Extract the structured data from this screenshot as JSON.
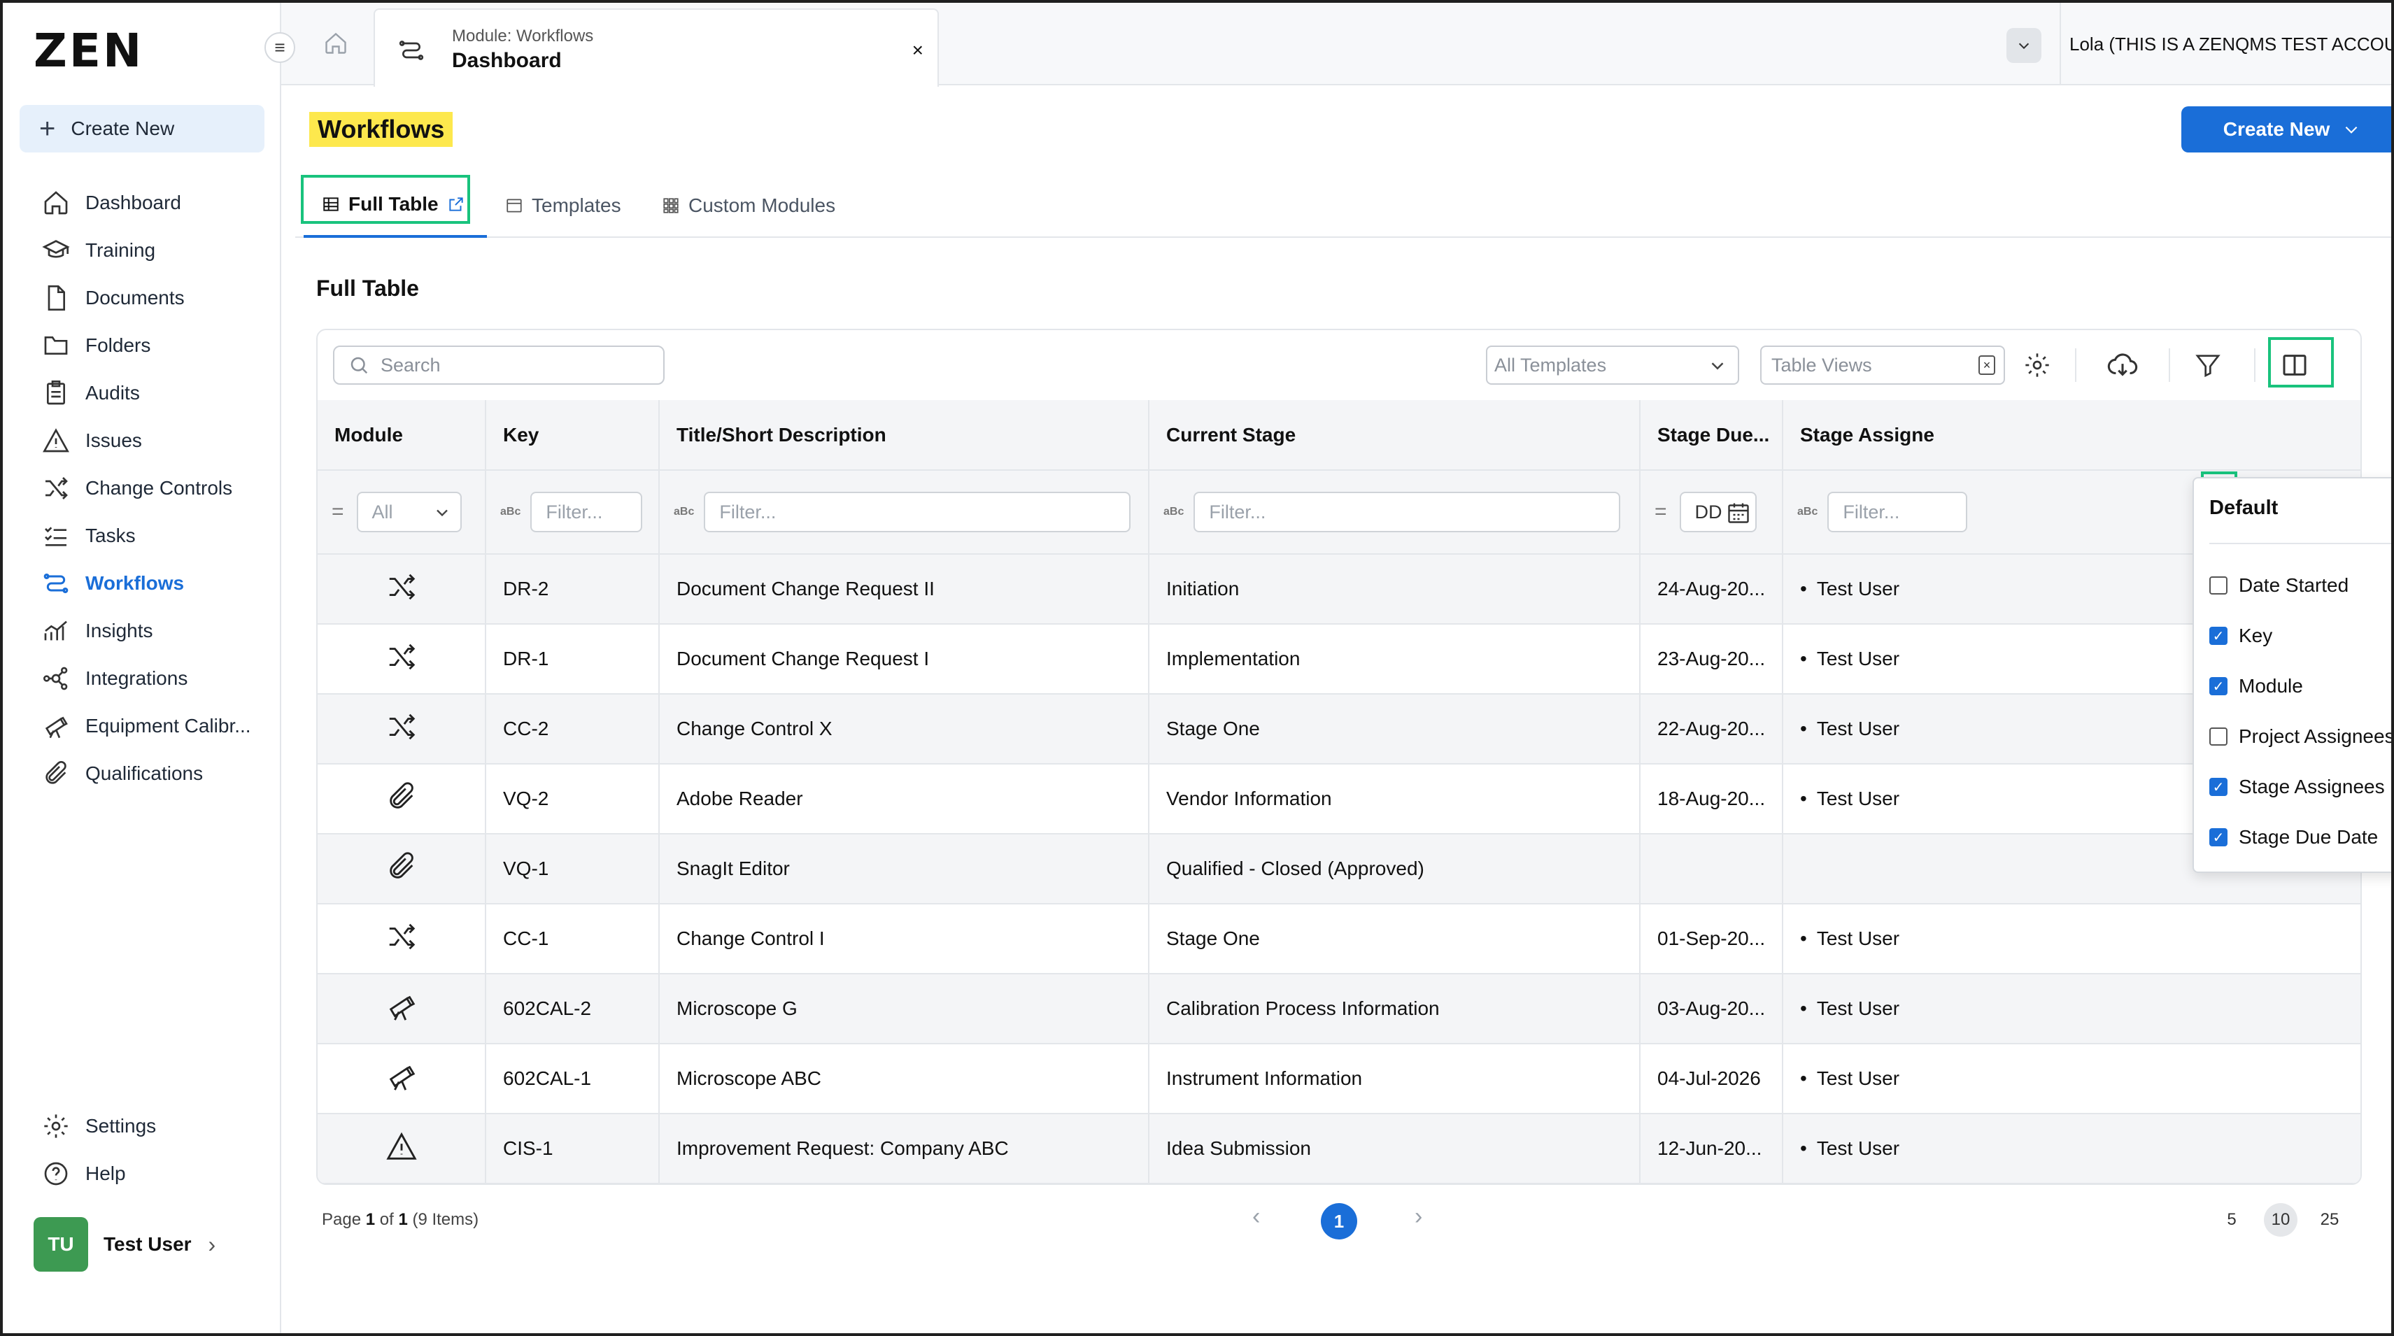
{
  "app": {
    "logo": "ZEN",
    "account": "Lola (THIS IS A ZENQMS TEST ACCOUNT)"
  },
  "tab": {
    "subtitle": "Module: Workflows",
    "title": "Dashboard",
    "close": "×"
  },
  "sidebar": {
    "create_new": "Create New",
    "items": [
      {
        "label": "Dashboard",
        "icon": "home-icon"
      },
      {
        "label": "Training",
        "icon": "graduation-cap-icon"
      },
      {
        "label": "Documents",
        "icon": "document-icon"
      },
      {
        "label": "Folders",
        "icon": "folder-icon"
      },
      {
        "label": "Audits",
        "icon": "clipboard-icon"
      },
      {
        "label": "Issues",
        "icon": "warning-icon"
      },
      {
        "label": "Change Controls",
        "icon": "shuffle-icon"
      },
      {
        "label": "Tasks",
        "icon": "task-list-icon"
      },
      {
        "label": "Workflows",
        "icon": "workflow-icon"
      },
      {
        "label": "Insights",
        "icon": "chart-icon"
      },
      {
        "label": "Integrations",
        "icon": "network-icon"
      },
      {
        "label": "Equipment Calibr...",
        "icon": "telescope-icon"
      },
      {
        "label": "Qualifications",
        "icon": "paperclip-icon"
      }
    ],
    "bottom": [
      {
        "label": "Settings",
        "icon": "gear-icon"
      },
      {
        "label": "Help",
        "icon": "help-icon"
      }
    ],
    "user": {
      "initials": "TU",
      "name": "Test User"
    }
  },
  "main": {
    "heading": "Workflows",
    "create_new": "Create New",
    "tabs": [
      {
        "label": "Full Table"
      },
      {
        "label": "Templates"
      },
      {
        "label": "Custom Modules"
      }
    ],
    "section_title": "Full Table"
  },
  "toolbar": {
    "search_placeholder": "Search",
    "templates_select": "All Templates",
    "views_select": "Table Views"
  },
  "table": {
    "columns": [
      "Module",
      "Key",
      "Title/Short Description",
      "Current Stage",
      "Stage Due...",
      "Stage Assigne"
    ],
    "filters": {
      "module": "All",
      "key": "Filter...",
      "title": "Filter...",
      "stage": "Filter...",
      "due": "DD",
      "assignee": "Filter..."
    },
    "rows": [
      {
        "module_icon": "shuffle-icon",
        "key": "DR-2",
        "title": "Document Change Request II",
        "stage": "Initiation",
        "due": "24-Aug-20...",
        "assignee": "Test User"
      },
      {
        "module_icon": "shuffle-icon",
        "key": "DR-1",
        "title": "Document Change Request I",
        "stage": "Implementation",
        "due": "23-Aug-20...",
        "assignee": "Test User"
      },
      {
        "module_icon": "shuffle-icon",
        "key": "CC-2",
        "title": "Change Control X",
        "stage": "Stage One",
        "due": "22-Aug-20...",
        "assignee": "Test User"
      },
      {
        "module_icon": "paperclip-icon",
        "key": "VQ-2",
        "title": "Adobe Reader",
        "stage": "Vendor Information",
        "due": "18-Aug-20...",
        "assignee": "Test User"
      },
      {
        "module_icon": "paperclip-icon",
        "key": "VQ-1",
        "title": "SnagIt Editor",
        "stage": "Qualified - Closed (Approved)",
        "due": "",
        "assignee": ""
      },
      {
        "module_icon": "shuffle-icon",
        "key": "CC-1",
        "title": "Change Control I",
        "stage": "Stage One",
        "due": "01-Sep-20...",
        "assignee": "Test User"
      },
      {
        "module_icon": "telescope-icon",
        "key": "602CAL-2",
        "title": "Microscope G",
        "stage": "Calibration Process Information",
        "due": "03-Aug-20...",
        "assignee": "Test User"
      },
      {
        "module_icon": "telescope-icon",
        "key": "602CAL-1",
        "title": "Microscope ABC",
        "stage": "Instrument Information",
        "due": "04-Jul-2026",
        "assignee": "Test User"
      },
      {
        "module_icon": "warning-icon",
        "key": "CIS-1",
        "title": "Improvement Request: Company ABC",
        "stage": "Idea Submission",
        "due": "12-Jun-20...",
        "assignee": "Test User"
      }
    ]
  },
  "column_panel": {
    "heading": "Default",
    "options": [
      {
        "label": "Date Started",
        "checked": false
      },
      {
        "label": "Key",
        "checked": true
      },
      {
        "label": "Module",
        "checked": true
      },
      {
        "label": "Project Assignees",
        "checked": false
      },
      {
        "label": "Stage Assignees",
        "checked": true
      },
      {
        "label": "Stage Due Date",
        "checked": true
      }
    ]
  },
  "pagination": {
    "info_prefix": "Page ",
    "page": "1",
    "info_of": " of ",
    "total_pages": "1",
    "info_suffix": " (9 Items)",
    "current": "1",
    "sizes": [
      "5",
      "10",
      "25"
    ],
    "selected_size": "10"
  },
  "colors": {
    "accent": "#1a6ed8",
    "highlight": "#fde84d",
    "annotation": "#19c37d"
  }
}
